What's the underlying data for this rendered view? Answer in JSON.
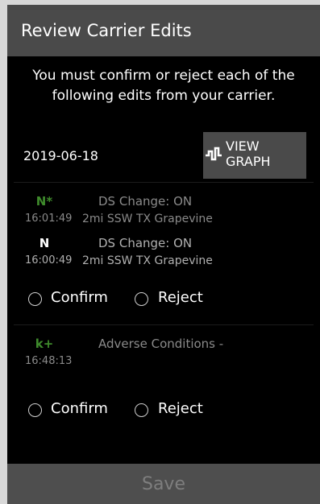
{
  "dialog": {
    "title": "Review Carrier Edits",
    "notice": "You must confirm or reject each of the following edits from your carrier.",
    "date": "2019-06-18",
    "view_graph_label_1": "VIEW",
    "view_graph_label_2": "GRAPH"
  },
  "groups": [
    {
      "entries": [
        {
          "code": "N*",
          "code_color": "#3f8b2c",
          "description": "DS Change: ON",
          "time": "16:01:49",
          "location": "2mi SSW TX Grapevine"
        },
        {
          "code": "N",
          "code_color": "#ffffff",
          "description": "DS Change: ON",
          "time": "16:00:49",
          "location": "2mi SSW TX Grapevine"
        }
      ],
      "confirm_label": "Confirm",
      "reject_label": "Reject"
    },
    {
      "entries": [
        {
          "code": "k+",
          "code_color": "#3f8b2c",
          "description": "Adverse Conditions -",
          "time": "16:48:13",
          "location": ""
        }
      ],
      "confirm_label": "Confirm",
      "reject_label": "Reject"
    }
  ],
  "footer": {
    "save_label": "Save"
  }
}
